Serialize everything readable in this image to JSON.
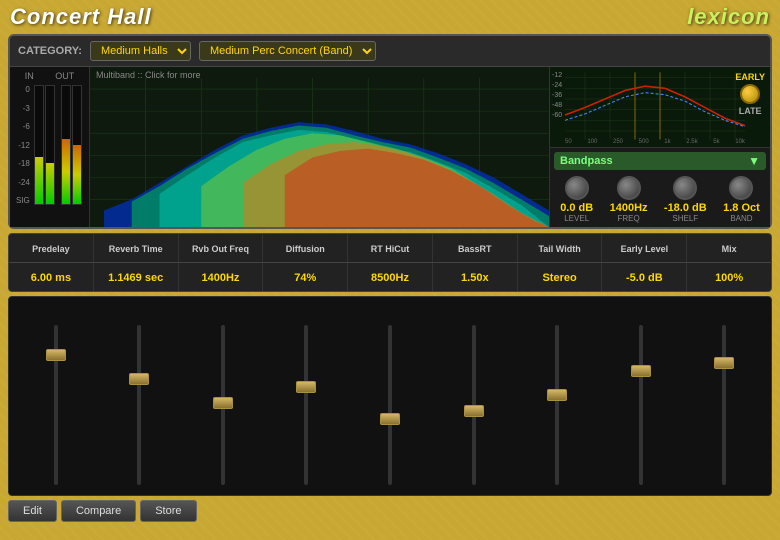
{
  "header": {
    "app_title": "Concert Hall",
    "brand_title": "lexicon"
  },
  "category": {
    "label": "CATEGORY:",
    "selected": "Medium Halls",
    "preset": "Medium Perc Concert (Band)"
  },
  "spectrum": {
    "title": "Multiband :: Click for more"
  },
  "eq": {
    "db_labels": [
      "-12",
      "-24",
      "-36",
      "-48",
      "-60"
    ],
    "freq_labels": [
      "50",
      "100",
      "250",
      "500",
      "1k",
      "2.5k",
      "5k",
      "10k"
    ],
    "early_label": "EARLY",
    "late_label": "LATE"
  },
  "bandpass": {
    "title": "Bandpass",
    "params": [
      {
        "value": "0.0 dB",
        "label": "LEVEL"
      },
      {
        "value": "1400Hz",
        "label": "FREQ"
      },
      {
        "value": "-18.0 dB",
        "label": "SHELF"
      },
      {
        "value": "1.8 Oct",
        "label": "BAND"
      }
    ]
  },
  "vu": {
    "in_label": "IN",
    "out_label": "OUT",
    "ticks": [
      "0",
      "-3",
      "-6",
      "-12",
      "-18",
      "-24",
      "SIG"
    ]
  },
  "parameters": [
    {
      "name": "Predelay",
      "value": "6.00 ms"
    },
    {
      "name": "Reverb Time",
      "value": "1.1469 sec"
    },
    {
      "name": "Rvb Out Freq",
      "value": "1400Hz"
    },
    {
      "name": "Diffusion",
      "value": "74%"
    },
    {
      "name": "RT HiCut",
      "value": "8500Hz"
    },
    {
      "name": "BassRT",
      "value": "1.50x"
    },
    {
      "name": "Tail Width",
      "value": "Stereo"
    },
    {
      "name": "Early Level",
      "value": "-5.0 dB"
    },
    {
      "name": "Mix",
      "value": "100%"
    }
  ],
  "faders": [
    {
      "height_pct": 85
    },
    {
      "height_pct": 70
    },
    {
      "height_pct": 55
    },
    {
      "height_pct": 65
    },
    {
      "height_pct": 45
    },
    {
      "height_pct": 50
    },
    {
      "height_pct": 60
    },
    {
      "height_pct": 75
    },
    {
      "height_pct": 80
    }
  ],
  "toolbar": {
    "buttons": [
      "Edit",
      "Compare",
      "Store"
    ]
  }
}
